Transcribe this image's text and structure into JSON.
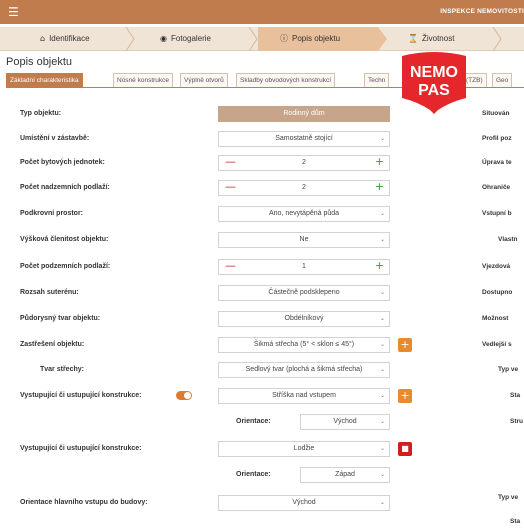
{
  "topbar": {
    "menu_icon": "hamburger-icon",
    "title": "INSPEKCE NEMOVITOSTI"
  },
  "steps": [
    {
      "label": "Identifikace",
      "icon": "home-icon",
      "active": false
    },
    {
      "label": "Fotogalerie",
      "icon": "camera-icon",
      "active": false
    },
    {
      "label": "Popis objektu",
      "icon": "info-icon",
      "active": true
    },
    {
      "label": "Životnost",
      "icon": "hourglass-icon",
      "active": false
    }
  ],
  "page_title": "Popis objektu",
  "tabs": [
    {
      "label": "Základní charakteristika",
      "active": true
    },
    {
      "label": "Nosné konstrukce",
      "active": false
    },
    {
      "label": "Výplně otvorů",
      "active": false
    },
    {
      "label": "Skladby obvodových konstrukcí",
      "active": false
    },
    {
      "label": "Techn",
      "active": false
    },
    {
      "label": "(TZB)",
      "active": false
    },
    {
      "label": "Geo",
      "active": false
    }
  ],
  "stamp": {
    "line1": "NEMO",
    "line2": "PAS"
  },
  "form": {
    "typ_objektu": {
      "label": "Typ objektu:",
      "value": "Rodinný dům"
    },
    "umisteni": {
      "label": "Umístění v zástavbě:",
      "value": "Samostatně stojící"
    },
    "pocet_bytovych": {
      "label": "Počet bytových jednotek:",
      "value": "2"
    },
    "pocet_nadzemnich": {
      "label": "Počet nadzemních podlaží:",
      "value": "2"
    },
    "podkrovni": {
      "label": "Podkrovní prostor:",
      "value": "Ano, nevytápěná půda"
    },
    "vyskova": {
      "label": "Výšková členitost objektu:",
      "value": "Ne"
    },
    "pocet_podzemnich": {
      "label": "Počet podzemních podlaží:",
      "value": "1"
    },
    "rozsah_suterenu": {
      "label": "Rozsah suterénu:",
      "value": "Částečně podsklepeno"
    },
    "pudorysny_tvar": {
      "label": "Půdorysný tvar objektu:",
      "value": "Obdélníkový"
    },
    "zastreseni": {
      "label": "Zastřešení objektu:",
      "value": "Šikmá střecha (5° < sklon ≤ 45°)"
    },
    "tvar_strechy": {
      "label": "Tvar střechy:",
      "value": "Sedlový tvar (plochá a šikmá střecha)"
    },
    "vystupujici_1": {
      "label": "Vystupující či ustupující konstrukce:",
      "value": "Stříška nad vstupem"
    },
    "orientace_1": {
      "label": "Orientace:",
      "value": "Východ"
    },
    "vystupujici_2": {
      "label": "Vystupující či ustupující konstrukce:",
      "value": "Lodžie"
    },
    "orientace_2": {
      "label": "Orientace:",
      "value": "Západ"
    },
    "orientace_vstupu": {
      "label": "Orientace hlavního vstupu do budovy:",
      "value": "Východ"
    }
  },
  "right_labels": [
    "Situován",
    "Profil poz",
    "Úprava te",
    "Ohraniče",
    "Vstupní b",
    "Vlastn",
    "Vjezdová",
    "Dostupno",
    "Možnost",
    "Vedlejší s",
    "Typ ve",
    "Sta",
    "Stru",
    "Typ ve",
    "Sta"
  ],
  "colors": {
    "brand": "#c07c4c",
    "plus": "#27a22d",
    "minus": "#d01e1e",
    "stamp": "#e5262a",
    "add_button": "#e88a2e"
  }
}
